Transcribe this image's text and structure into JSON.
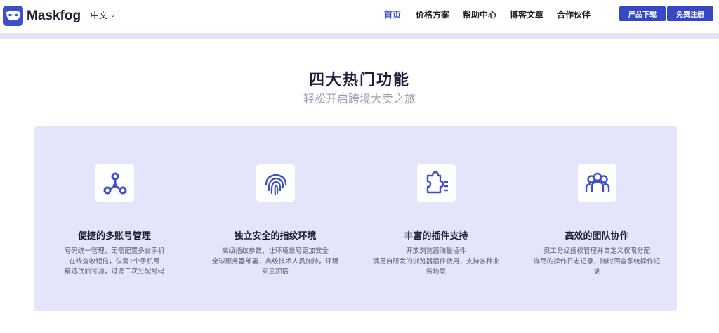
{
  "header": {
    "brand": "Maskfog",
    "language": "中文",
    "nav": [
      "首页",
      "价格方案",
      "帮助中心",
      "博客文章",
      "合作伙伴"
    ],
    "download_label": "产品下载",
    "register_label": "免费注册"
  },
  "section": {
    "title": "四大热门功能",
    "subtitle": "轻松开启跨境大卖之旅"
  },
  "features": [
    {
      "icon": "network-nodes-icon",
      "title": "便捷的多账号管理",
      "desc": [
        "号码统一管理，无需配置多台手机",
        "在线查收短信，仅需1个手机号",
        "精选优质号源，过滤二次分配号码"
      ]
    },
    {
      "icon": "fingerprint-icon",
      "title": "独立安全的指纹环境",
      "desc": [
        "高级指纹参数，让环境帐号更加安全",
        "全球服务器部署，高级技术人员加持，环境",
        "安全加倍"
      ]
    },
    {
      "icon": "puzzle-plugin-icon",
      "title": "丰富的插件支持",
      "desc": [
        "开放浏览器海量插件",
        "满足自研发的浏览器插件使用，支持各种业",
        "务场景"
      ]
    },
    {
      "icon": "team-icon",
      "title": "高效的团队协作",
      "desc": [
        "员工分级授权管理并自定义权限分配",
        "详尽的操作日志记录，随时回查系统操作记",
        "录"
      ]
    }
  ],
  "colors": {
    "accent": "#3748c7",
    "panel": "#e3e5fa",
    "band": "#e2e4fa"
  }
}
